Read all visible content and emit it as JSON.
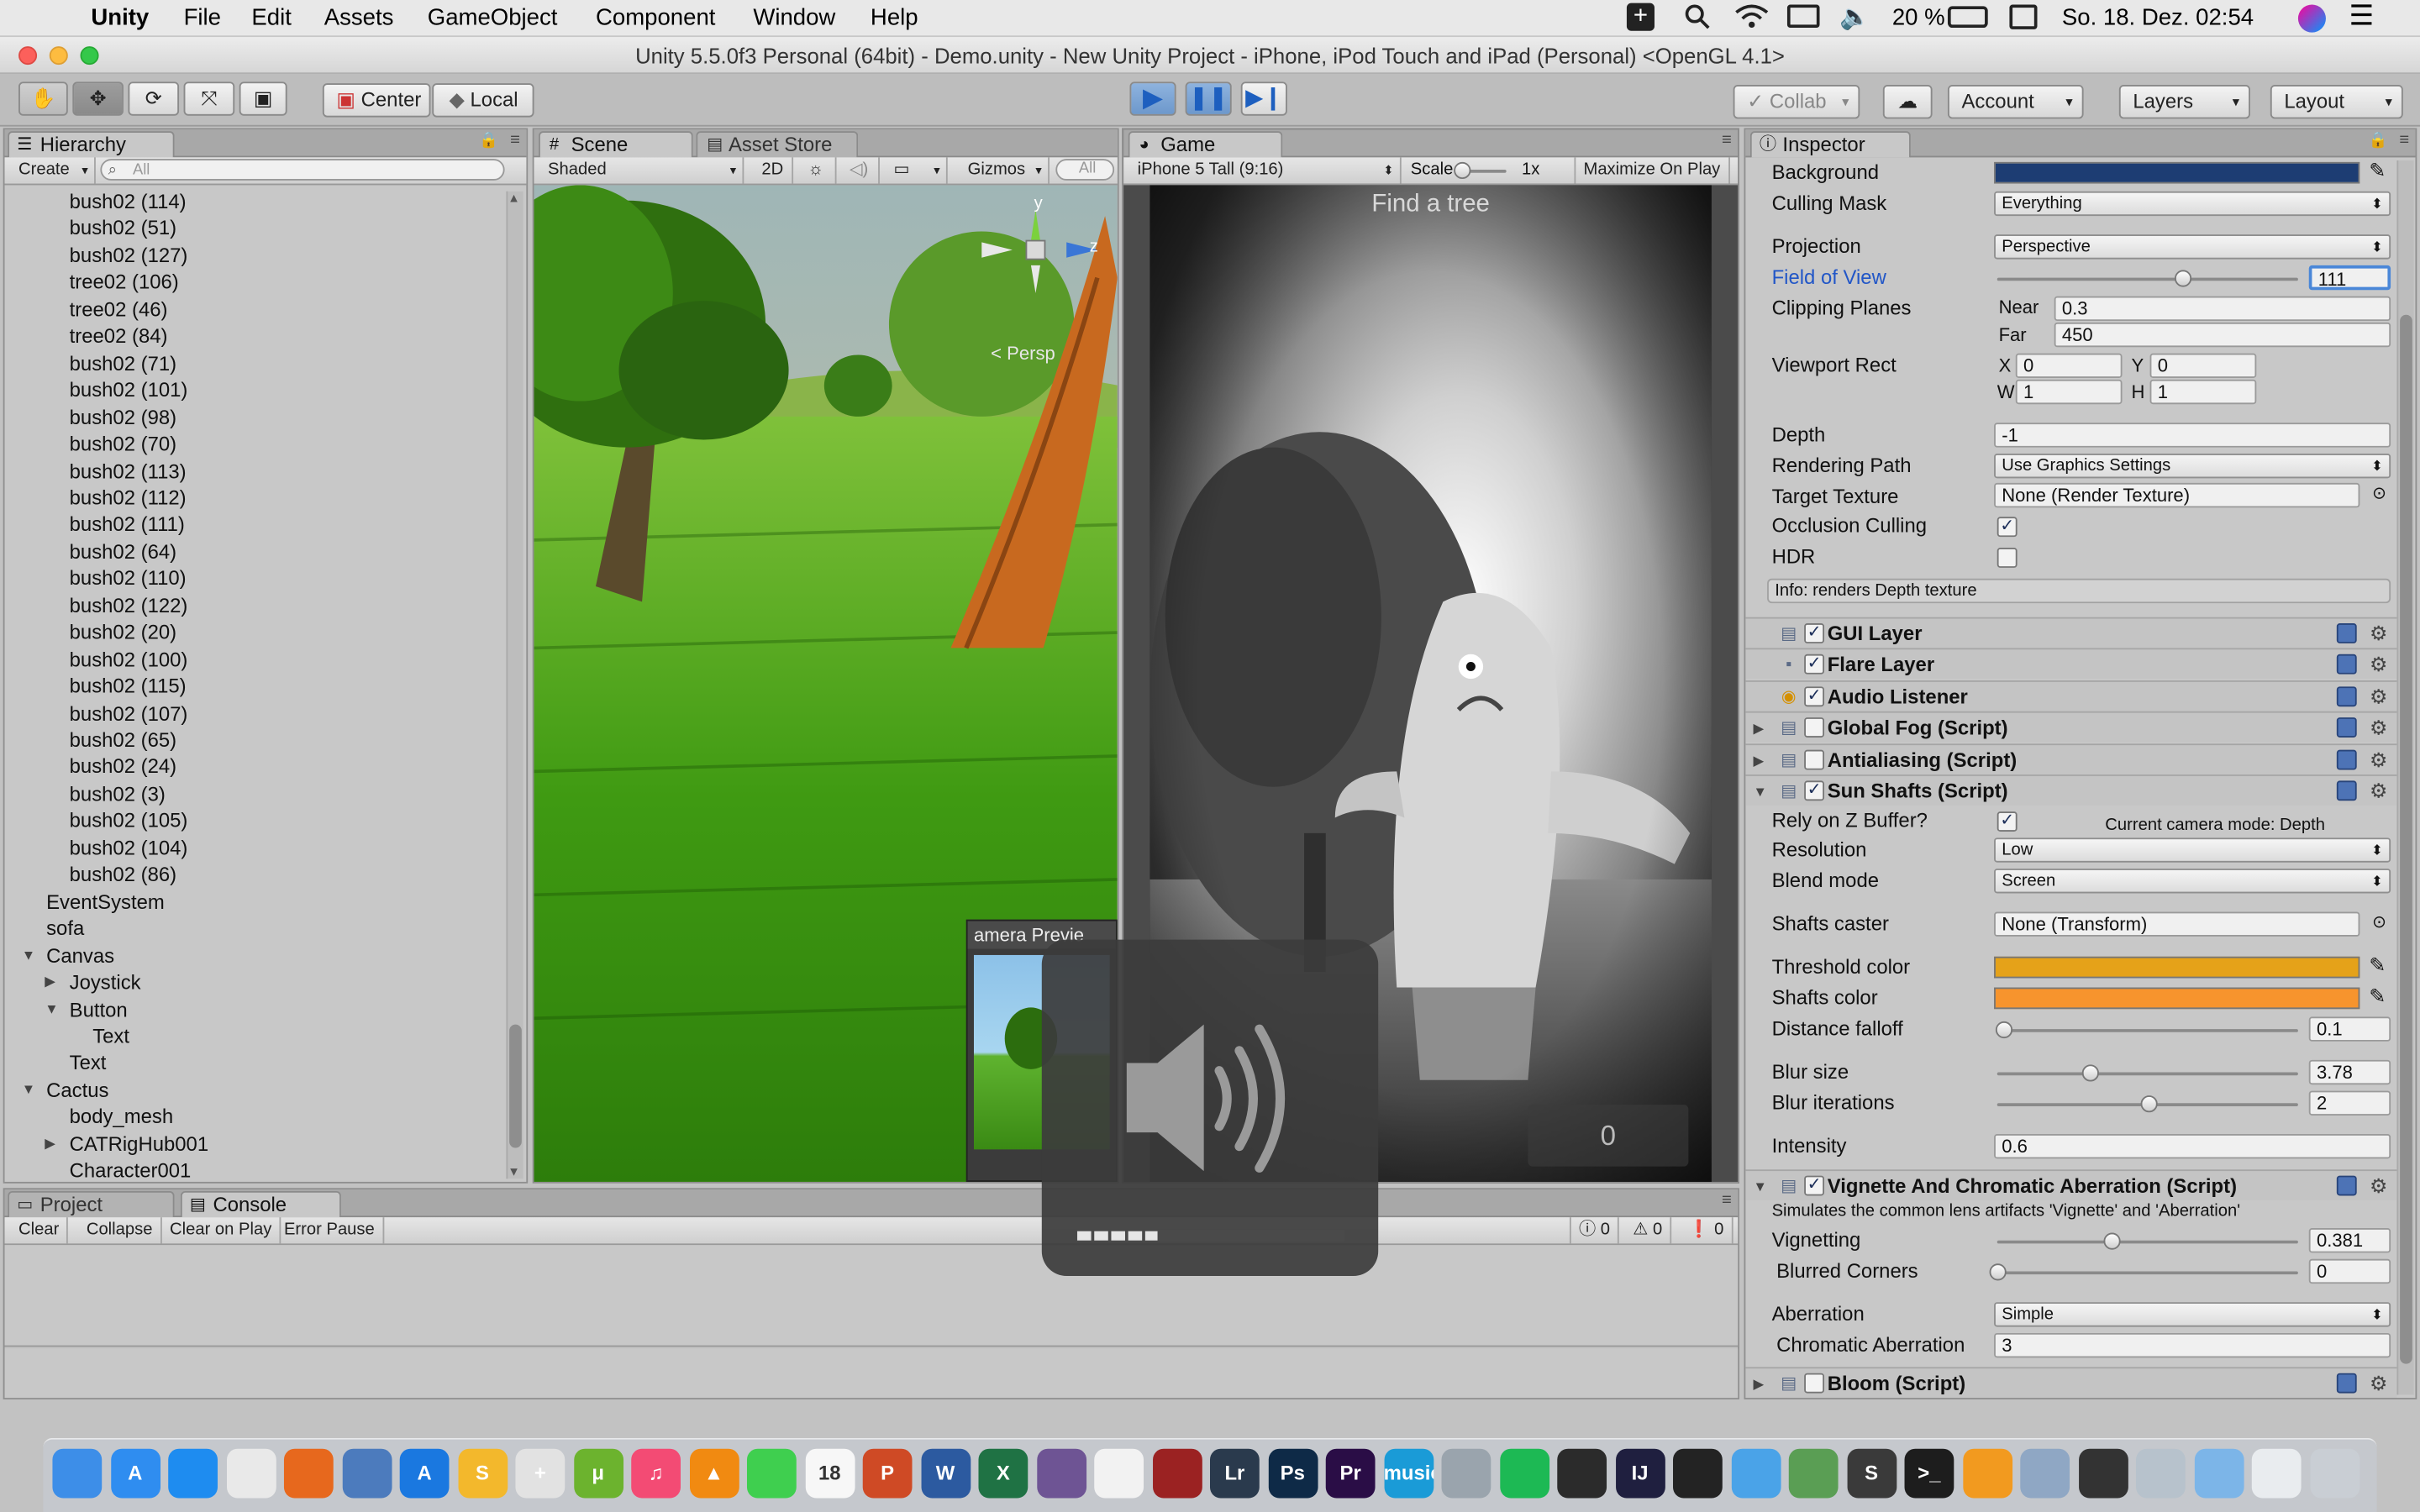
{
  "menubar": {
    "app_name": "Unity",
    "items": [
      "File",
      "Edit",
      "Assets",
      "GameObject",
      "Component",
      "Window",
      "Help"
    ],
    "battery": "20 %",
    "datetime": "So. 18. Dez. 02:54"
  },
  "window": {
    "title": "Unity 5.5.0f3 Personal (64bit) - Demo.unity - New Unity Project - iPhone, iPod Touch and iPad (Personal) <OpenGL 4.1>"
  },
  "toolbar": {
    "pivot_center": "Center",
    "pivot_local": "Local",
    "collab": "Collab",
    "account": "Account",
    "layers": "Layers",
    "layout": "Layout"
  },
  "hierarchy": {
    "tab": "Hierarchy",
    "create": "Create",
    "search_placeholder": "All",
    "items": [
      {
        "label": "bush02 (114)",
        "indent": 2,
        "expander": ""
      },
      {
        "label": "bush02 (51)",
        "indent": 2,
        "expander": ""
      },
      {
        "label": "bush02 (127)",
        "indent": 2,
        "expander": ""
      },
      {
        "label": "tree02 (106)",
        "indent": 2,
        "expander": ""
      },
      {
        "label": "tree02 (46)",
        "indent": 2,
        "expander": ""
      },
      {
        "label": "tree02 (84)",
        "indent": 2,
        "expander": ""
      },
      {
        "label": "bush02 (71)",
        "indent": 2,
        "expander": ""
      },
      {
        "label": "bush02 (101)",
        "indent": 2,
        "expander": ""
      },
      {
        "label": "bush02 (98)",
        "indent": 2,
        "expander": ""
      },
      {
        "label": "bush02 (70)",
        "indent": 2,
        "expander": ""
      },
      {
        "label": "bush02 (113)",
        "indent": 2,
        "expander": ""
      },
      {
        "label": "bush02 (112)",
        "indent": 2,
        "expander": ""
      },
      {
        "label": "bush02 (111)",
        "indent": 2,
        "expander": ""
      },
      {
        "label": "bush02 (64)",
        "indent": 2,
        "expander": ""
      },
      {
        "label": "bush02 (110)",
        "indent": 2,
        "expander": ""
      },
      {
        "label": "bush02 (122)",
        "indent": 2,
        "expander": ""
      },
      {
        "label": "bush02 (20)",
        "indent": 2,
        "expander": ""
      },
      {
        "label": "bush02 (100)",
        "indent": 2,
        "expander": ""
      },
      {
        "label": "bush02 (115)",
        "indent": 2,
        "expander": ""
      },
      {
        "label": "bush02 (107)",
        "indent": 2,
        "expander": ""
      },
      {
        "label": "bush02 (65)",
        "indent": 2,
        "expander": ""
      },
      {
        "label": "bush02 (24)",
        "indent": 2,
        "expander": ""
      },
      {
        "label": "bush02 (3)",
        "indent": 2,
        "expander": ""
      },
      {
        "label": "bush02 (105)",
        "indent": 2,
        "expander": ""
      },
      {
        "label": "bush02 (104)",
        "indent": 2,
        "expander": ""
      },
      {
        "label": "bush02 (86)",
        "indent": 2,
        "expander": ""
      },
      {
        "label": "EventSystem",
        "indent": 1,
        "expander": ""
      },
      {
        "label": "sofa",
        "indent": 1,
        "expander": ""
      },
      {
        "label": "Canvas",
        "indent": 1,
        "expander": "▼"
      },
      {
        "label": "Joystick",
        "indent": 2,
        "expander": "▶"
      },
      {
        "label": "Button",
        "indent": 2,
        "expander": "▼"
      },
      {
        "label": "Text",
        "indent": 3,
        "expander": ""
      },
      {
        "label": "Text",
        "indent": 2,
        "expander": ""
      },
      {
        "label": "Cactus",
        "indent": 1,
        "expander": "▼"
      },
      {
        "label": "body_mesh",
        "indent": 2,
        "expander": ""
      },
      {
        "label": "CATRigHub001",
        "indent": 2,
        "expander": "▶"
      },
      {
        "label": "Character001",
        "indent": 2,
        "expander": ""
      }
    ]
  },
  "scene": {
    "tab": "Scene",
    "tab2": "Asset Store",
    "shading": "Shaded",
    "mode_2d": "2D",
    "gizmos": "Gizmos",
    "search_placeholder": "All",
    "persp": "< Persp",
    "axis_y": "y",
    "axis_z": "z",
    "camera_preview": "amera Previe"
  },
  "game": {
    "tab": "Game",
    "aspect": "iPhone 5 Tall (9:16)",
    "scale_label": "Scale",
    "scale_value": "1x",
    "maximize": "Maximize On Play",
    "hud_title": "Find a tree",
    "hud_score": "0"
  },
  "volume_overlay": {
    "level": 0.32,
    "segments": 16
  },
  "console": {
    "tab_project": "Project",
    "tab_console": "Console",
    "buttons": [
      "Clear",
      "Collapse",
      "Clear on Play",
      "Error Pause"
    ],
    "counts": [
      "0",
      "0",
      "0"
    ]
  },
  "inspector": {
    "tab": "Inspector",
    "background_label": "Background",
    "background_color": "#1d3d73",
    "culling_mask": {
      "label": "Culling Mask",
      "value": "Everything"
    },
    "projection": {
      "label": "Projection",
      "value": "Perspective"
    },
    "fov": {
      "label": "Field of View",
      "value": "111",
      "level": 0.617
    },
    "clipping": {
      "label": "Clipping Planes",
      "near_label": "Near",
      "near": "0.3",
      "far_label": "Far",
      "far": "450"
    },
    "viewport": {
      "label": "Viewport Rect",
      "x_label": "X",
      "x": "0",
      "y_label": "Y",
      "y": "0",
      "w_label": "W",
      "w": "1",
      "h_label": "H",
      "h": "1"
    },
    "depth": {
      "label": "Depth",
      "value": "-1"
    },
    "rendering_path": {
      "label": "Rendering Path",
      "value": "Use Graphics Settings"
    },
    "target_texture": {
      "label": "Target Texture",
      "value": "None (Render Texture)"
    },
    "occlusion": {
      "label": "Occlusion Culling",
      "checked": true
    },
    "hdr": {
      "label": "HDR",
      "checked": false
    },
    "info": "Info: renders Depth texture",
    "components": [
      {
        "name": "GUI Layer",
        "checked": true,
        "expander": ""
      },
      {
        "name": "Flare Layer",
        "checked": true,
        "expander": ""
      },
      {
        "name": "Audio Listener",
        "checked": true,
        "expander": ""
      },
      {
        "name": "Global Fog (Script)",
        "checked": false,
        "expander": "▶"
      },
      {
        "name": "Antialiasing (Script)",
        "checked": false,
        "expander": "▶"
      },
      {
        "name": "Sun Shafts (Script)",
        "checked": true,
        "expander": "▼"
      }
    ],
    "sunshafts": {
      "rely_z": {
        "label": "Rely on Z Buffer?",
        "checked": true
      },
      "camera_mode": "Current camera mode: Depth",
      "resolution": {
        "label": "Resolution",
        "value": "Low"
      },
      "blend": {
        "label": "Blend mode",
        "value": "Screen"
      },
      "caster": {
        "label": "Shafts caster",
        "value": "None (Transform)"
      },
      "threshold": {
        "label": "Threshold color",
        "color": "#e5a219"
      },
      "shafts_color": {
        "label": "Shafts color",
        "color": "#f7942d"
      },
      "falloff": {
        "label": "Distance falloff",
        "value": "0.1",
        "level": 0.02
      },
      "blur_size": {
        "label": "Blur size",
        "value": "3.78",
        "level": 0.31
      },
      "blur_iter": {
        "label": "Blur iterations",
        "value": "2",
        "level": 0.5
      },
      "intensity": {
        "label": "Intensity",
        "value": "0.6"
      }
    },
    "vignette": {
      "name": "Vignette And Chromatic Aberration (Script)",
      "checked": true,
      "desc": "Simulates the common lens artifacts 'Vignette' and 'Aberration'",
      "vignetting": {
        "label": "Vignetting",
        "value": "0.381",
        "level": 0.381
      },
      "blurred": {
        "label": "Blurred Corners",
        "value": "0",
        "level": 0.0
      },
      "aberration": {
        "label": "Aberration",
        "value": "Simple"
      },
      "chromatic": {
        "label": "Chromatic Aberration",
        "value": "3"
      }
    },
    "bloom": {
      "name": "Bloom (Script)",
      "checked": false
    }
  },
  "dock": {
    "apps": [
      {
        "name": "finder",
        "text": "",
        "color": "#3d8ee8"
      },
      {
        "name": "app-store",
        "text": "A",
        "color": "#2f8df0"
      },
      {
        "name": "safari",
        "text": "",
        "color": "#1e8cf0"
      },
      {
        "name": "chrome",
        "text": "",
        "color": "#e9e9e9"
      },
      {
        "name": "firefox",
        "text": "",
        "color": "#e7681d"
      },
      {
        "name": "thunderbird",
        "text": "",
        "color": "#4c7bbd"
      },
      {
        "name": "xcode-instruments",
        "text": "A",
        "color": "#1a78e0"
      },
      {
        "name": "sketch",
        "text": "S",
        "color": "#f3b82c"
      },
      {
        "name": "unity-hub",
        "text": "+",
        "color": "#e2e2e2"
      },
      {
        "name": "utorrent",
        "text": "μ",
        "color": "#6cb32e"
      },
      {
        "name": "itunes",
        "text": "♫",
        "color": "#f34b74"
      },
      {
        "name": "vlc",
        "text": "▲",
        "color": "#f18a11"
      },
      {
        "name": "messages",
        "text": "",
        "color": "#3fcf4f"
      },
      {
        "name": "calendar",
        "text": "18",
        "color": "#f7f7f7"
      },
      {
        "name": "powerpoint",
        "text": "P",
        "color": "#cf4a25"
      },
      {
        "name": "word",
        "text": "W",
        "color": "#2c5aa0"
      },
      {
        "name": "excel",
        "text": "X",
        "color": "#1f7244"
      },
      {
        "name": "github-desktop",
        "text": "",
        "color": "#6e5494"
      },
      {
        "name": "photos",
        "text": "",
        "color": "#f2f2f2"
      },
      {
        "name": "photo-booth",
        "text": "",
        "color": "#9b2222"
      },
      {
        "name": "lightroom",
        "text": "Lr",
        "color": "#2a3a4d"
      },
      {
        "name": "photoshop",
        "text": "Ps",
        "color": "#0e2a47"
      },
      {
        "name": "premiere",
        "text": "Pr",
        "color": "#2a0d46"
      },
      {
        "name": "amazon-music",
        "text": "music",
        "color": "#1a9bd7"
      },
      {
        "name": "disk-utility",
        "text": "",
        "color": "#9aa4ad"
      },
      {
        "name": "spotify",
        "text": "",
        "color": "#1db954"
      },
      {
        "name": "unity",
        "text": "",
        "color": "#2b2b2b"
      },
      {
        "name": "intellij",
        "text": "IJ",
        "color": "#1f1f3f"
      },
      {
        "name": "github",
        "text": "",
        "color": "#232323"
      },
      {
        "name": "xcode",
        "text": "",
        "color": "#4aa3e8"
      },
      {
        "name": "android-studio",
        "text": "",
        "color": "#5a9e54"
      },
      {
        "name": "sublime",
        "text": "S",
        "color": "#3a3a3a"
      },
      {
        "name": "terminal",
        "text": ">_",
        "color": "#1d1d1d"
      },
      {
        "name": "ibooks",
        "text": "",
        "color": "#f29a1f"
      },
      {
        "name": "preview",
        "text": "",
        "color": "#8fa7c4"
      },
      {
        "name": "activity-monitor",
        "text": "",
        "color": "#333333"
      },
      {
        "name": "network-utility",
        "text": "",
        "color": "#b7c2cc"
      },
      {
        "name": "downloads-folder",
        "text": "",
        "color": "#7cb5e8"
      },
      {
        "name": "documents-stack",
        "text": "",
        "color": "#e9ecef"
      },
      {
        "name": "trash",
        "text": "",
        "color": "#c9ced4"
      }
    ]
  }
}
